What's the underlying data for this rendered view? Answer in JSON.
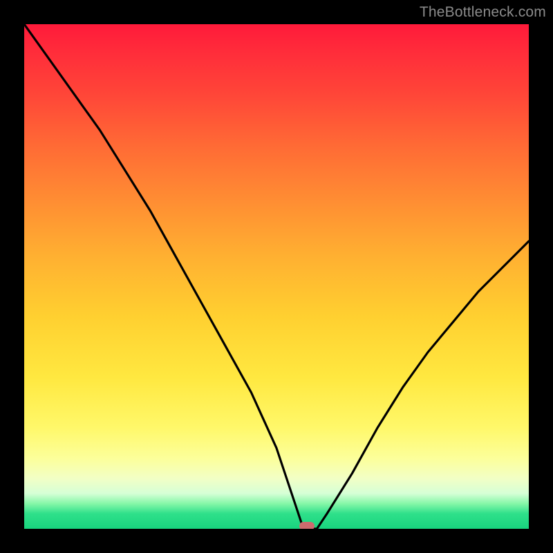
{
  "watermark": {
    "text": "TheBottleneck.com"
  },
  "chart_data": {
    "type": "line",
    "title": "",
    "xlabel": "",
    "ylabel": "",
    "xlim": [
      0,
      100
    ],
    "ylim": [
      0,
      100
    ],
    "grid": false,
    "legend": false,
    "series": [
      {
        "name": "bottleneck-curve",
        "x": [
          0,
          5,
          10,
          15,
          20,
          25,
          30,
          35,
          40,
          45,
          50,
          52,
          54,
          55,
          56,
          58,
          60,
          65,
          70,
          75,
          80,
          85,
          90,
          95,
          100
        ],
        "y": [
          100,
          93,
          86,
          79,
          71,
          63,
          54,
          45,
          36,
          27,
          16,
          10,
          4,
          1,
          0,
          0,
          3,
          11,
          20,
          28,
          35,
          41,
          47,
          52,
          57
        ]
      }
    ],
    "marker": {
      "x": 56,
      "y": 0.5,
      "color": "#cc6b6e"
    },
    "background_gradient": {
      "from": "#ff1a3a",
      "to": "#18d47e",
      "stops": [
        {
          "pos": 0.0,
          "color": "#ff1a3a"
        },
        {
          "pos": 0.3,
          "color": "#ff8a33"
        },
        {
          "pos": 0.6,
          "color": "#ffd030"
        },
        {
          "pos": 0.85,
          "color": "#fcff9a"
        },
        {
          "pos": 1.0,
          "color": "#18d47e"
        }
      ]
    }
  }
}
